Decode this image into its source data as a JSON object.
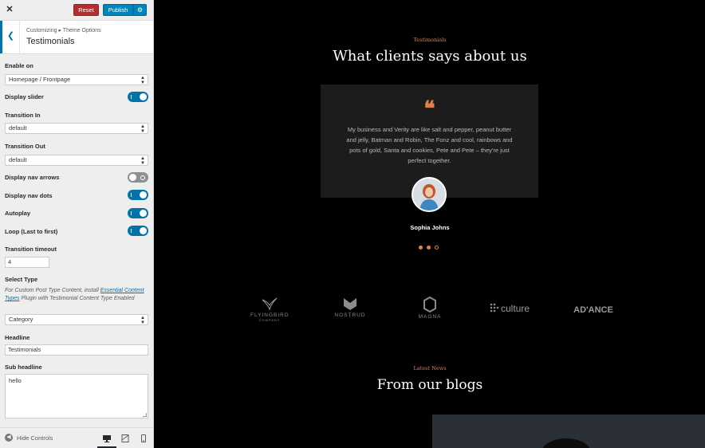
{
  "topbar": {
    "reset_label": "Reset",
    "publish_label": "Publish"
  },
  "section": {
    "breadcrumb": "Customizing ▸ Theme Options",
    "title": "Testimonials"
  },
  "controls": {
    "enable_on": {
      "label": "Enable on",
      "value": "Homepage / Frontpage"
    },
    "display_slider": {
      "label": "Display slider",
      "on": true
    },
    "transition_in": {
      "label": "Transition In",
      "value": "default"
    },
    "transition_out": {
      "label": "Transition Out",
      "value": "default"
    },
    "display_nav_arrows": {
      "label": "Display nav arrows",
      "on": false
    },
    "display_nav_dots": {
      "label": "Display nav dots",
      "on": true
    },
    "autoplay": {
      "label": "Autoplay",
      "on": true
    },
    "loop": {
      "label": "Loop (Last to first)",
      "on": true
    },
    "transition_timeout": {
      "label": "Transition timeout",
      "value": "4"
    },
    "select_type": {
      "label": "Select Type",
      "desc_prefix": "For Custom Post Type Content, install ",
      "desc_link": "Essential Content Types",
      "desc_suffix": " Plugin with Testimonial Content Type Enabled",
      "value": "Category"
    },
    "headline": {
      "label": "Headline",
      "value": "Testimonials"
    },
    "sub_headline": {
      "label": "Sub headline",
      "value": "hello"
    }
  },
  "footer": {
    "hide_controls_label": "Hide Controls",
    "devices": [
      "desktop-icon",
      "tablet-icon",
      "mobile-icon"
    ]
  },
  "preview": {
    "testimonials": {
      "eyebrow": "Testimonials",
      "heading": "What clients says about us",
      "quote": "My business and Verity are like salt and pepper, peanut butter and jelly, Batman and Robin, The Fonz and cool, rainbows and pots of gold, Santa and cookies, Pete and Pete – they're just perfect together.",
      "person": "Sophia Johns"
    },
    "logos": [
      "FLYINGBIRD",
      "NOSTRUD",
      "MAGNA",
      "culture",
      "AD'ANCE"
    ],
    "flyingbird_sub": "COMPANY",
    "news": {
      "eyebrow": "Latest News",
      "heading": "From our blogs"
    }
  },
  "colors": {
    "accent": "#0073aa",
    "brand_orange": "#e0804a",
    "reset_red": "#b32d2e"
  }
}
